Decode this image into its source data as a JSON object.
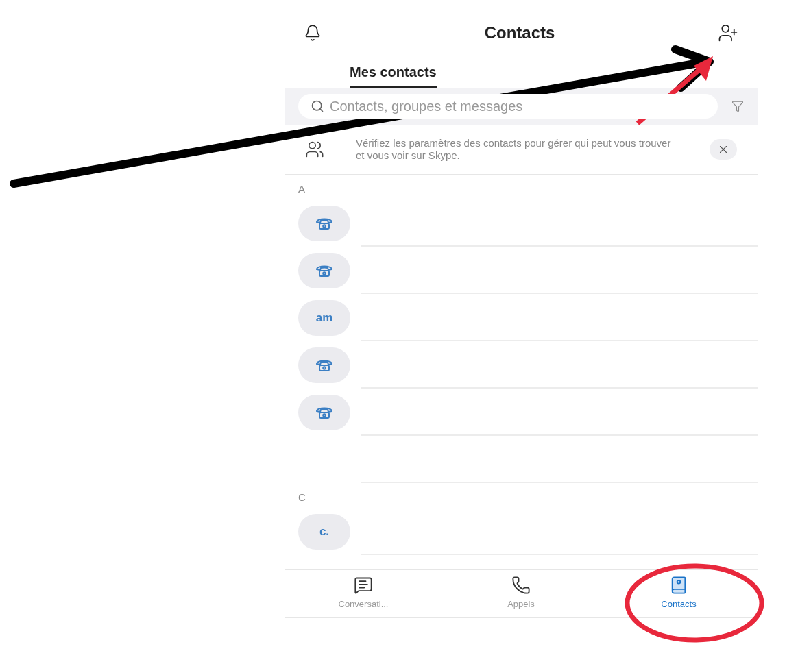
{
  "header": {
    "title": "Contacts"
  },
  "tabs": [
    {
      "label": "Mes contacts",
      "selected": true
    }
  ],
  "search": {
    "placeholder": "Contacts, groupes et messages"
  },
  "notice": {
    "text": "Vérifiez les paramètres des contacts pour gérer qui peut vous trouver et vous voir sur Skype."
  },
  "sections": [
    {
      "letter": "A",
      "contacts": [
        {
          "avatar": {
            "kind": "phone"
          }
        },
        {
          "avatar": {
            "kind": "phone"
          }
        },
        {
          "avatar": {
            "kind": "initials",
            "text": "am"
          }
        },
        {
          "avatar": {
            "kind": "phone"
          }
        },
        {
          "avatar": {
            "kind": "phone"
          }
        },
        {
          "avatar": {
            "kind": "none"
          }
        }
      ]
    },
    {
      "letter": "C",
      "contacts": [
        {
          "avatar": {
            "kind": "initials",
            "text": "c."
          }
        }
      ]
    }
  ],
  "bottom_nav": [
    {
      "label": "Conversati...",
      "selected": false
    },
    {
      "label": "Appels",
      "selected": false
    },
    {
      "label": "Contacts",
      "selected": true
    }
  ]
}
